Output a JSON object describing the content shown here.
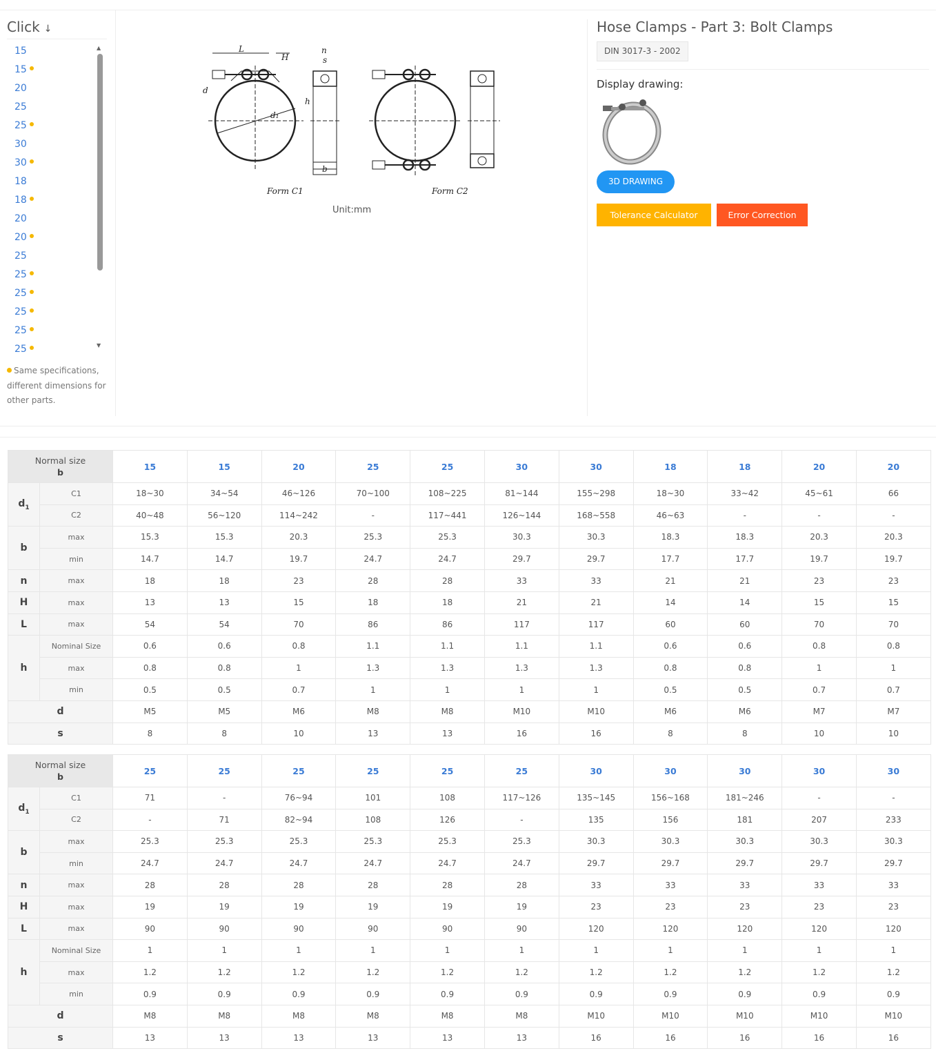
{
  "sidebar": {
    "title": "Click",
    "arrow": "↓",
    "items": [
      {
        "label": "15",
        "dot": false
      },
      {
        "label": "15",
        "dot": true
      },
      {
        "label": "20",
        "dot": false
      },
      {
        "label": "25",
        "dot": false
      },
      {
        "label": "25",
        "dot": true
      },
      {
        "label": "30",
        "dot": false
      },
      {
        "label": "30",
        "dot": true
      },
      {
        "label": "18",
        "dot": false
      },
      {
        "label": "18",
        "dot": true
      },
      {
        "label": "20",
        "dot": false
      },
      {
        "label": "20",
        "dot": true
      },
      {
        "label": "25",
        "dot": false
      },
      {
        "label": "25",
        "dot": true
      },
      {
        "label": "25",
        "dot": true
      },
      {
        "label": "25",
        "dot": true
      },
      {
        "label": "25",
        "dot": true
      },
      {
        "label": "25",
        "dot": true
      }
    ],
    "note": "Same specifications, different dimensions for other parts."
  },
  "drawing": {
    "form_c1": "Form C1",
    "form_c2": "Form C2",
    "labels": {
      "L": "L",
      "H": "H",
      "n": "n",
      "s": "s",
      "d": "d",
      "d1": "d₁",
      "h": "h",
      "b": "b"
    },
    "unit": "Unit:mm"
  },
  "info": {
    "title": "Hose Clamps - Part 3: Bolt Clamps",
    "standard": "DIN 3017-3 - 2002",
    "display_label": "Display drawing:",
    "btn_3d": "3D DRAWING",
    "btn_tolerance": "Tolerance Calculator",
    "btn_error": "Error Correction"
  },
  "table_labels": {
    "normal_size": "Normal size",
    "normal_size_sub": "b",
    "d1": "d",
    "d1_sub": "1",
    "b": "b",
    "n": "n",
    "H": "H",
    "L": "L",
    "h": "h",
    "d": "d",
    "s": "s",
    "C1": "C1",
    "C2": "C2",
    "max": "max",
    "min": "min",
    "nominal": "Nominal Size"
  },
  "tables": [
    {
      "sizes": [
        "15",
        "15",
        "20",
        "25",
        "25",
        "30",
        "30",
        "18",
        "18",
        "20",
        "20"
      ],
      "d1_c1": [
        "18~30",
        "34~54",
        "46~126",
        "70~100",
        "108~225",
        "81~144",
        "155~298",
        "18~30",
        "33~42",
        "45~61",
        "66"
      ],
      "d1_c2": [
        "40~48",
        "56~120",
        "114~242",
        "-",
        "117~441",
        "126~144",
        "168~558",
        "46~63",
        "-",
        "-",
        "-"
      ],
      "b_max": [
        "15.3",
        "15.3",
        "20.3",
        "25.3",
        "25.3",
        "30.3",
        "30.3",
        "18.3",
        "18.3",
        "20.3",
        "20.3"
      ],
      "b_min": [
        "14.7",
        "14.7",
        "19.7",
        "24.7",
        "24.7",
        "29.7",
        "29.7",
        "17.7",
        "17.7",
        "19.7",
        "19.7"
      ],
      "n_max": [
        "18",
        "18",
        "23",
        "28",
        "28",
        "33",
        "33",
        "21",
        "21",
        "23",
        "23"
      ],
      "H_max": [
        "13",
        "13",
        "15",
        "18",
        "18",
        "21",
        "21",
        "14",
        "14",
        "15",
        "15"
      ],
      "L_max": [
        "54",
        "54",
        "70",
        "86",
        "86",
        "117",
        "117",
        "60",
        "60",
        "70",
        "70"
      ],
      "h_nom": [
        "0.6",
        "0.6",
        "0.8",
        "1.1",
        "1.1",
        "1.1",
        "1.1",
        "0.6",
        "0.6",
        "0.8",
        "0.8"
      ],
      "h_max": [
        "0.8",
        "0.8",
        "1",
        "1.3",
        "1.3",
        "1.3",
        "1.3",
        "0.8",
        "0.8",
        "1",
        "1"
      ],
      "h_min": [
        "0.5",
        "0.5",
        "0.7",
        "1",
        "1",
        "1",
        "1",
        "0.5",
        "0.5",
        "0.7",
        "0.7"
      ],
      "d": [
        "M5",
        "M5",
        "M6",
        "M8",
        "M8",
        "M10",
        "M10",
        "M6",
        "M6",
        "M7",
        "M7"
      ],
      "s": [
        "8",
        "8",
        "10",
        "13",
        "13",
        "16",
        "16",
        "8",
        "8",
        "10",
        "10"
      ]
    },
    {
      "sizes": [
        "25",
        "25",
        "25",
        "25",
        "25",
        "25",
        "30",
        "30",
        "30",
        "30",
        "30"
      ],
      "d1_c1": [
        "71",
        "-",
        "76~94",
        "101",
        "108",
        "117~126",
        "135~145",
        "156~168",
        "181~246",
        "-",
        "-"
      ],
      "d1_c2": [
        "-",
        "71",
        "82~94",
        "108",
        "126",
        "-",
        "135",
        "156",
        "181",
        "207",
        "233"
      ],
      "b_max": [
        "25.3",
        "25.3",
        "25.3",
        "25.3",
        "25.3",
        "25.3",
        "30.3",
        "30.3",
        "30.3",
        "30.3",
        "30.3"
      ],
      "b_min": [
        "24.7",
        "24.7",
        "24.7",
        "24.7",
        "24.7",
        "24.7",
        "29.7",
        "29.7",
        "29.7",
        "29.7",
        "29.7"
      ],
      "n_max": [
        "28",
        "28",
        "28",
        "28",
        "28",
        "28",
        "33",
        "33",
        "33",
        "33",
        "33"
      ],
      "H_max": [
        "19",
        "19",
        "19",
        "19",
        "19",
        "19",
        "23",
        "23",
        "23",
        "23",
        "23"
      ],
      "L_max": [
        "90",
        "90",
        "90",
        "90",
        "90",
        "90",
        "120",
        "120",
        "120",
        "120",
        "120"
      ],
      "h_nom": [
        "1",
        "1",
        "1",
        "1",
        "1",
        "1",
        "1",
        "1",
        "1",
        "1",
        "1"
      ],
      "h_max": [
        "1.2",
        "1.2",
        "1.2",
        "1.2",
        "1.2",
        "1.2",
        "1.2",
        "1.2",
        "1.2",
        "1.2",
        "1.2"
      ],
      "h_min": [
        "0.9",
        "0.9",
        "0.9",
        "0.9",
        "0.9",
        "0.9",
        "0.9",
        "0.9",
        "0.9",
        "0.9",
        "0.9"
      ],
      "d": [
        "M8",
        "M8",
        "M8",
        "M8",
        "M8",
        "M8",
        "M10",
        "M10",
        "M10",
        "M10",
        "M10"
      ],
      "s": [
        "13",
        "13",
        "13",
        "13",
        "13",
        "13",
        "16",
        "16",
        "16",
        "16",
        "16"
      ]
    }
  ]
}
